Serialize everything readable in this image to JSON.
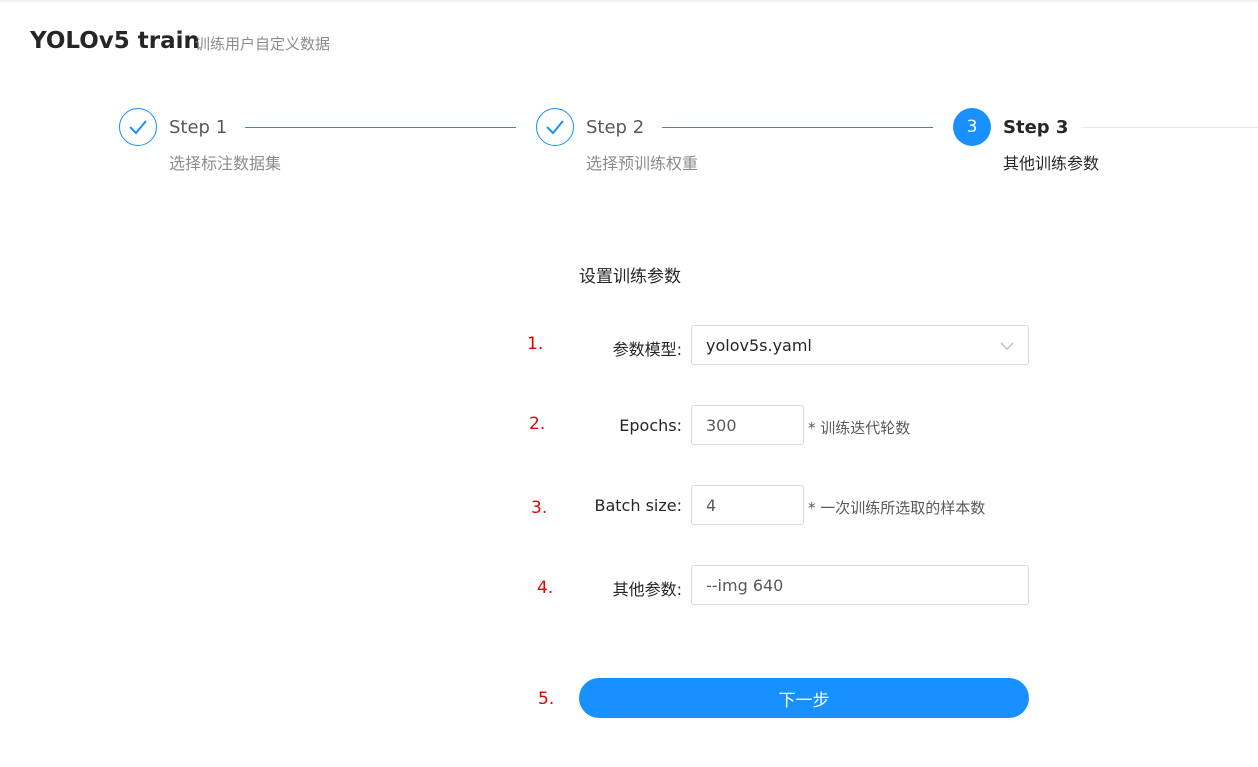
{
  "header": {
    "title": "YOLOv5 train",
    "subtitle": "训练用户自定义数据"
  },
  "steps": [
    {
      "title": "Step 1",
      "description": "选择标注数据集",
      "status": "finished"
    },
    {
      "title": "Step 2",
      "description": "选择预训练权重",
      "status": "finished"
    },
    {
      "number": "3",
      "title": "Step 3",
      "description": "其他训练参数",
      "status": "active"
    }
  ],
  "form": {
    "section_title": "设置训练参数",
    "markers": [
      "1.",
      "2.",
      "3.",
      "4.",
      "5."
    ],
    "model": {
      "label": "参数模型:",
      "value": "yolov5s.yaml"
    },
    "epochs": {
      "label": "Epochs:",
      "value": "300",
      "hint": "* 训练迭代轮数"
    },
    "batch_size": {
      "label": "Batch size:",
      "value": "4",
      "hint": "* 一次训练所选取的样本数"
    },
    "other": {
      "label": "其他参数:",
      "value": "--img 640"
    },
    "next_button": "下一步"
  },
  "colors": {
    "primary": "#1890ff",
    "marker": "#e60000",
    "border": "#d9d9d9"
  }
}
